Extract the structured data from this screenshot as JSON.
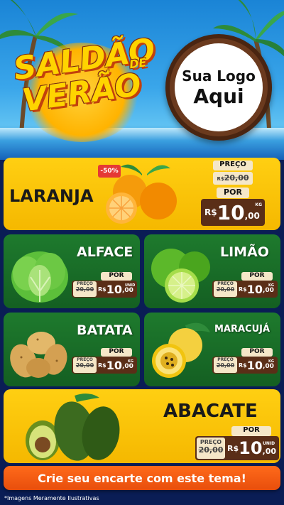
{
  "header": {
    "promo_line1": "SALDÃO",
    "promo_line2": "VERÃO",
    "promo_de": "DE",
    "logo_line1": "Sua Logo",
    "logo_line2": "Aqui"
  },
  "labels": {
    "preco": "PREÇO",
    "por": "POR",
    "currency": "R$"
  },
  "products": {
    "laranja": {
      "name": "LARANJA",
      "discount": "-50%",
      "old_price": "20,00",
      "new_int": "10",
      "new_dec": ",00",
      "unit": "KG"
    },
    "alface": {
      "name": "ALFACE",
      "old_price": "20,00",
      "new_int": "10",
      "new_dec": ",00",
      "unit": "UNID"
    },
    "limao": {
      "name": "LIMÃO",
      "old_price": "20,00",
      "new_int": "10",
      "new_dec": ",00",
      "unit": "KG"
    },
    "batata": {
      "name": "BATATA",
      "old_price": "20,00",
      "new_int": "10",
      "new_dec": ",00",
      "unit": "KG"
    },
    "maracuja": {
      "name": "MARACUJÁ",
      "old_price": "20,00",
      "new_int": "10",
      "new_dec": ",00",
      "unit": "KG"
    },
    "abacate": {
      "name": "ABACATE",
      "old_price": "20,00",
      "new_int": "10",
      "new_dec": ",00",
      "unit": "UNID"
    }
  },
  "cta": {
    "label": "Crie seu encarte com este tema!"
  },
  "footnote": "*Imagens Meramente Ilustrativas",
  "colors": {
    "yellow_card": "#f5b800",
    "green_card": "#1e7a2d",
    "price_brown": "#5a2e17",
    "cta_orange": "#ff6a1a"
  }
}
